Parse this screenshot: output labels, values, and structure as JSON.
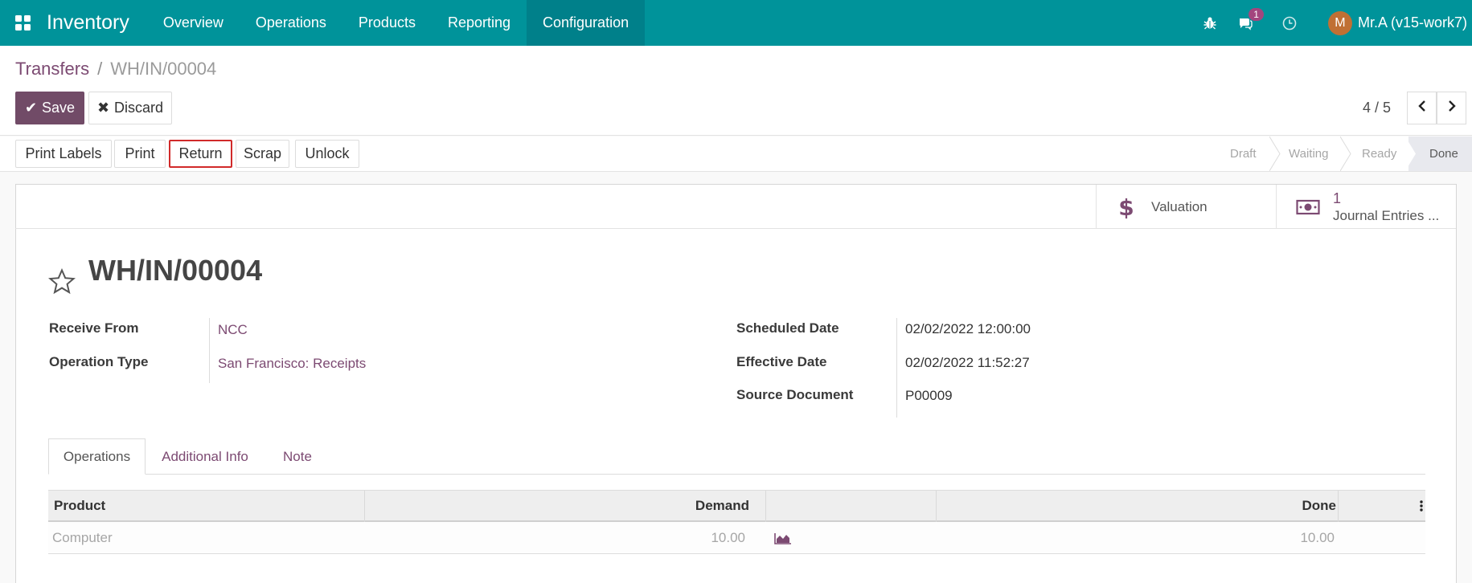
{
  "navbar": {
    "app_title": "Inventory",
    "menu": [
      "Overview",
      "Operations",
      "Products",
      "Reporting",
      "Configuration"
    ],
    "active_menu": "Configuration",
    "messages_badge": "1",
    "user_initial": "M",
    "user_name": "Mr.A (v15-work7)",
    "icons": [
      "apps-grid-icon",
      "bug-icon",
      "chat-icon",
      "clock-icon"
    ],
    "bg_color": "#00939a"
  },
  "breadcrumb": {
    "parent": "Transfers",
    "separator": "/",
    "current": "WH/IN/00004"
  },
  "actions": {
    "save_label": "Save",
    "discard_label": "Discard"
  },
  "pager": {
    "value": "4 / 5"
  },
  "statusbar": {
    "buttons": [
      "Print Labels",
      "Print",
      "Return",
      "Scrap",
      "Unlock"
    ],
    "highlighted_button": "Return",
    "stages": [
      "Draft",
      "Waiting",
      "Ready",
      "Done"
    ],
    "current_stage": "Done"
  },
  "smart_buttons": {
    "valuation_label": "Valuation",
    "journal_count": "1",
    "journal_label": "Journal Entries ..."
  },
  "record": {
    "title": "WH/IN/00004",
    "fields_left": [
      {
        "label": "Receive From",
        "value": "NCC"
      },
      {
        "label": "Operation Type",
        "value": "San Francisco: Receipts"
      }
    ],
    "fields_right": [
      {
        "label": "Scheduled Date",
        "value": "02/02/2022 12:00:00"
      },
      {
        "label": "Effective Date",
        "value": "02/02/2022 11:52:27"
      },
      {
        "label": "Source Document",
        "value": "P00009"
      }
    ]
  },
  "tabs": [
    "Operations",
    "Additional Info",
    "Note"
  ],
  "active_tab": "Operations",
  "operations_table": {
    "headers": {
      "product": "Product",
      "demand": "Demand",
      "done": "Done"
    },
    "rows": [
      {
        "product": "Computer",
        "demand": "10.00",
        "done": "10.00"
      }
    ]
  },
  "colors": {
    "primary": "#714b67",
    "link": "#7c4a72",
    "highlight_border": "#d12a2a"
  }
}
